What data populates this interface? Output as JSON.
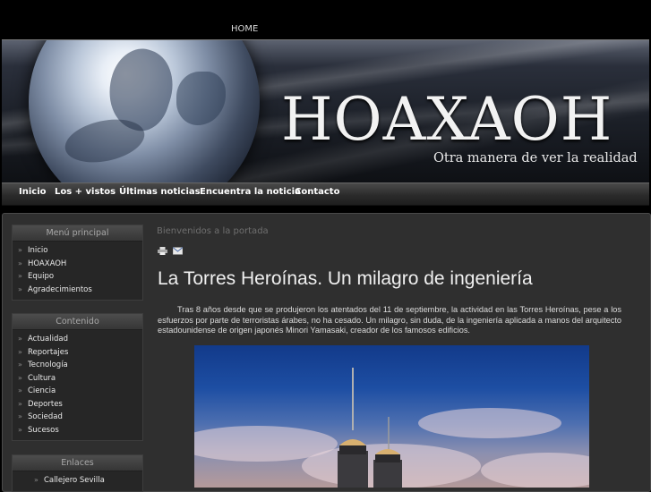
{
  "top": {
    "home_label": "HOME"
  },
  "banner": {
    "brand": "HOAXAOH",
    "tagline": "Otra manera de ver la realidad"
  },
  "nav": {
    "items": [
      "Inicio",
      "Los + vistos",
      "Últimas noticias",
      "Encuentra la noticia",
      "Contacto"
    ]
  },
  "sidebar": {
    "main_menu": {
      "title": "Menú principal",
      "items": [
        "Inicio",
        "HOAXAOH",
        "Equipo",
        "Agradecimientos"
      ]
    },
    "content_menu": {
      "title": "Contenido",
      "items": [
        "Actualidad",
        "Reportajes",
        "Tecnología",
        "Cultura",
        "Ciencia",
        "Deportes",
        "Sociedad",
        "Sucesos"
      ]
    },
    "links_menu": {
      "title": "Enlaces",
      "items": [
        "Callejero Sevilla"
      ]
    }
  },
  "main": {
    "welcome": "Bienvenidos a la portada",
    "icons": [
      "print-icon",
      "email-icon"
    ],
    "article_title": "La Torres Heroínas. Un milagro de ingeniería",
    "article_text": "Tras 8 años desde que se produjeron los atentados del 11 de septiembre, la actividad en las Torres Heroínas, pese a los esfuerzos por parte de terroristas árabes, no ha cesado. Un milagro, sin duda, de la ingeniería aplicada a manos del arquitecto estadounidense de origen japonés Minori Yamasaki, creador de los famosos edificios."
  },
  "colors": {
    "background": "#000000",
    "frame": "#2f2f2f",
    "title_text": "#f0f0f0",
    "muted_text": "#6f6f6f"
  }
}
